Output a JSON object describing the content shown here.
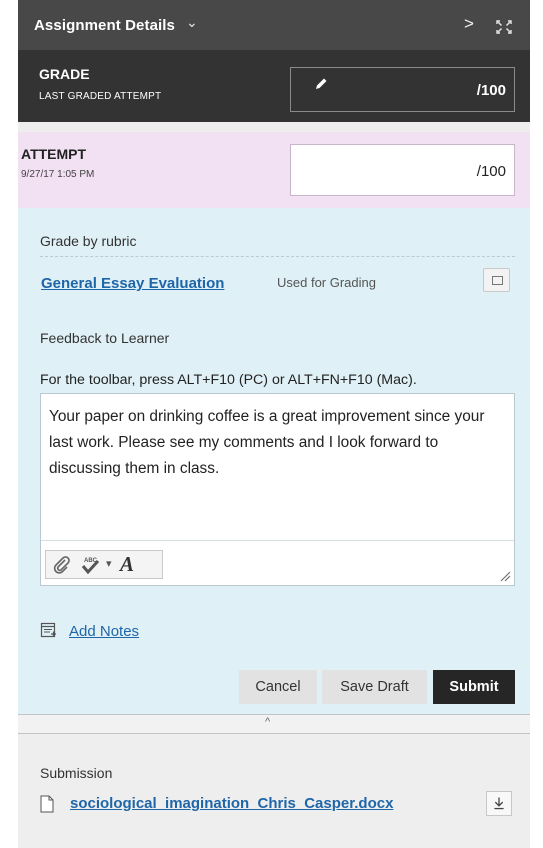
{
  "header": {
    "title": "Assignment Details",
    "title_chevron": "⌄",
    "next_label": ">",
    "next_icon": "chevron-right-icon",
    "expand_icon": "expand-icon"
  },
  "grade": {
    "label": "GRADE",
    "sublabel": "LAST GRADED ATTEMPT",
    "max": "/100",
    "edit_icon": "pencil-icon"
  },
  "attempt": {
    "label": "ATTEMPT",
    "date": "9/27/17 1:05 PM",
    "value": "",
    "max": "/100"
  },
  "rubric": {
    "label": "Grade by rubric",
    "name": "General Essay Evaluation",
    "usage": "Used for Grading",
    "open_icon": "window-icon"
  },
  "feedback": {
    "label": "Feedback to Learner",
    "toolbar_hint": "For the toolbar, press ALT+F10 (PC) or ALT+FN+F10 (Mac).",
    "text": "Your paper on drinking coffee is a great improvement since your last work. Please see my comments and I look forward to discussing them in class.",
    "toolbar": {
      "attach_icon": "paperclip-icon",
      "spell_icon": "spellcheck-icon",
      "spell_dropdown": "▾",
      "font_label": "A"
    }
  },
  "notes": {
    "label": "Add Notes",
    "icon": "notes-icon"
  },
  "actions": {
    "cancel": "Cancel",
    "save_draft": "Save Draft",
    "submit": "Submit"
  },
  "collapse": {
    "caret": "^"
  },
  "submission": {
    "label": "Submission",
    "file_name": "sociological_imagination_Chris_Casper.docx",
    "file_icon": "document-icon",
    "download_icon": "download-icon"
  },
  "colors": {
    "header_bg": "#484848",
    "grade_bg": "#333333",
    "attempt_bg": "#f2e0f3",
    "grading_bg": "#dff0f6",
    "link": "#1f66a8",
    "submit_bg": "#262626"
  }
}
